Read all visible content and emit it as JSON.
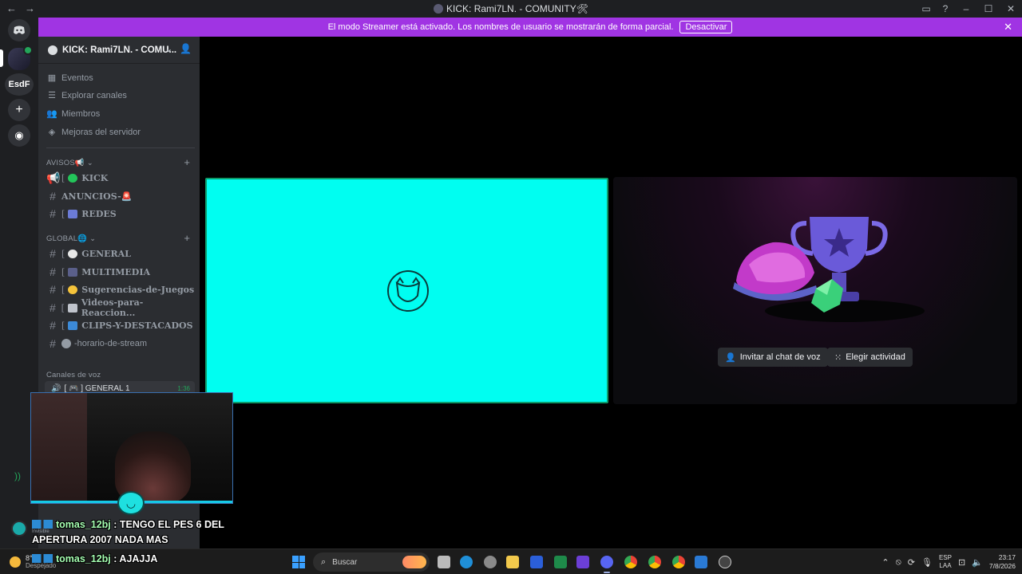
{
  "window": {
    "title": "KICK: Rami7LN. - COMUNITY🛠",
    "back_icon": "←",
    "forward_icon": "→"
  },
  "rail": {
    "esdf_label": "EsdF"
  },
  "banner": {
    "text": "El modo Streamer está activado. Los nombres de usuario se mostrarán de forma parcial.",
    "button": "Desactivar",
    "color": "#a034e3"
  },
  "server": {
    "name": "KICK: Rami7LN. - COMU...",
    "menu": [
      {
        "icon": "calendar-icon",
        "label": "Eventos"
      },
      {
        "icon": "list-icon",
        "label": "Explorar canales"
      },
      {
        "icon": "members-icon",
        "label": "Miembros"
      },
      {
        "icon": "boost-icon",
        "label": "Mejoras del servidor"
      }
    ],
    "categories": [
      {
        "name": "AVISOS📢 ⌄",
        "channels": [
          {
            "prefix": "[",
            "name": "KICK",
            "type": "announcement"
          },
          {
            "prefix": "",
            "name": "ANUNCIOS-🚨",
            "type": "text"
          },
          {
            "prefix": "[",
            "name": "REDES",
            "type": "text"
          }
        ]
      },
      {
        "name": "GLOBAL🌐 ⌄",
        "channels": [
          {
            "prefix": "[",
            "name": "GENERAL",
            "type": "text"
          },
          {
            "prefix": "[",
            "name": "MULTIMEDIA",
            "type": "text"
          },
          {
            "prefix": "[",
            "name": "Sugerencias-de-Juegos",
            "type": "text"
          },
          {
            "prefix": "[",
            "name": "Videos-para-Reaccion...",
            "type": "text"
          },
          {
            "prefix": "[",
            "name": "CLIPS-Y-DESTACADOS",
            "type": "text"
          },
          {
            "prefix": "",
            "name": "-horario-de-stream",
            "type": "text"
          }
        ]
      }
    ],
    "voice_category": "Canales de voz",
    "voice_channel": {
      "name": "[ 🎮 ] GENERAL 1",
      "time": "1:36"
    }
  },
  "user": {
    "status": "Invisible"
  },
  "chat": [
    {
      "user": "tomas_12bj",
      "message": " : TENGO EL PES 6 DEL",
      "cont": "APERTURA 2007 NADA MAS"
    },
    {
      "user": "tomas_12bj",
      "message": " : AJAJJA"
    }
  ],
  "activity": {
    "invite_button": "Invitar al chat de voz",
    "activity_button": "Elegir actividad"
  },
  "taskbar": {
    "weather_temp": "8°C",
    "weather_desc": "Despejado",
    "search_placeholder": "Buscar",
    "lang_line1": "ESP",
    "lang_line2": "LAA",
    "time": "23:17",
    "date": "7/8/2026"
  }
}
